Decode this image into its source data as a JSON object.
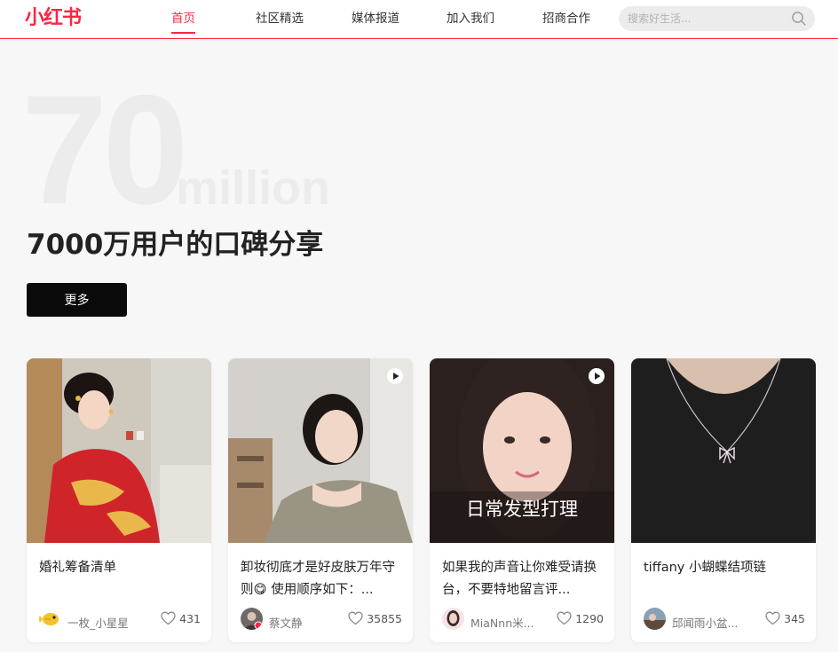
{
  "header": {
    "logo": "小红书",
    "nav": [
      "首页",
      "社区精选",
      "媒体报道",
      "加入我们",
      "招商合作"
    ],
    "active_index": 0,
    "search_placeholder": "搜索好生活...",
    "accent_color": "#ff2442"
  },
  "hero": {
    "big_number": "70",
    "unit": "million",
    "title": "7000万用户的口碑分享",
    "button_label": "更多"
  },
  "cards": [
    {
      "title": "婚礼筹备清单",
      "author": "一枚_小星星",
      "likes": "431",
      "video": false,
      "avatar_icon": "fish-avatar-icon"
    },
    {
      "title": "卸妆彻底才是好皮肤万年守则😋 使用顺序如下：...",
      "author": "蔡文静",
      "likes": "35855",
      "video": true,
      "avatar_icon": "user-avatar-icon"
    },
    {
      "title": "如果我的声音让你难受请换台，不要特地留言评...",
      "author": "MiaNnn米...",
      "likes": "1290",
      "video": true,
      "avatar_icon": "user-avatar-icon",
      "image_caption": "日常发型打理"
    },
    {
      "title": "tiffany 小蝴蝶结项链",
      "author": "邱闻雨小盆...",
      "likes": "345",
      "video": false,
      "avatar_icon": "user-avatar-icon"
    }
  ]
}
